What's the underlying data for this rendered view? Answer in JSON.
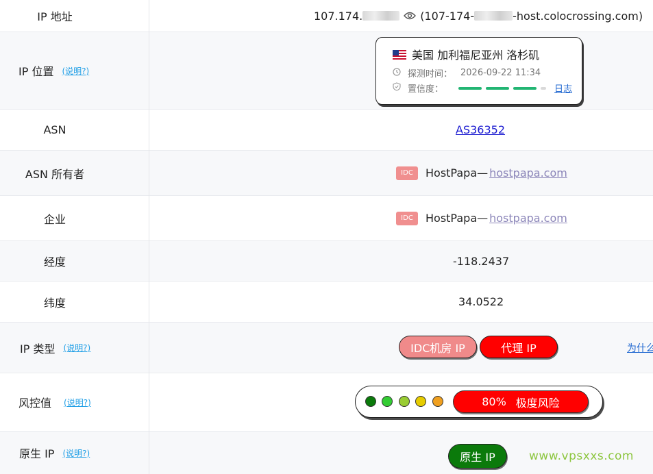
{
  "rows": {
    "ip": {
      "label": "IP 地址",
      "prefix": "107.174.",
      "paren_open": "(107-174-",
      "suffix": "-host.colocrossing.com)"
    },
    "location": {
      "label": "IP 位置",
      "help": "(说明?)",
      "place": "美国 加利福尼亚州 洛杉矶",
      "time_label": "探测时间：",
      "time_value": "2026-09-22 11:34",
      "confidence_label": "置信度：",
      "confidence_fraction": 0.9,
      "log_link": "日志"
    },
    "asn": {
      "label": "ASN",
      "value": "AS36352"
    },
    "asn_owner": {
      "label": "ASN 所有者",
      "badge": "IDC",
      "name": "HostPapa— ",
      "link": "hostpapa.com"
    },
    "enterprise": {
      "label": "企业",
      "badge": "IDC",
      "name": "HostPapa— ",
      "link": "hostpapa.com"
    },
    "longitude": {
      "label": "经度",
      "value": "-118.2437"
    },
    "latitude": {
      "label": "纬度",
      "value": "34.0522"
    },
    "ip_type": {
      "label": "IP 类型",
      "help": "(说明?)",
      "tag1": "IDC机房 IP",
      "tag2": "代理 IP",
      "why": "为什么"
    },
    "risk": {
      "label": "风控值",
      "help": "(说明?)",
      "value": "80%",
      "level": "极度风险",
      "dot_colors": [
        "#0b7a0b",
        "#33cc33",
        "#99cc33",
        "#e6cc00",
        "#f0a020"
      ]
    },
    "native": {
      "label": "原生 IP",
      "help": "(说明?)",
      "tag": "原生 IP"
    }
  },
  "watermark": "www.vpsxxs.com",
  "colors": {
    "link_blue": "#1e9ee6",
    "danger_red": "#ff0000",
    "idc_pink": "#f08a8a",
    "confidence_green": "#22b573",
    "native_green": "#0b7a0b"
  }
}
